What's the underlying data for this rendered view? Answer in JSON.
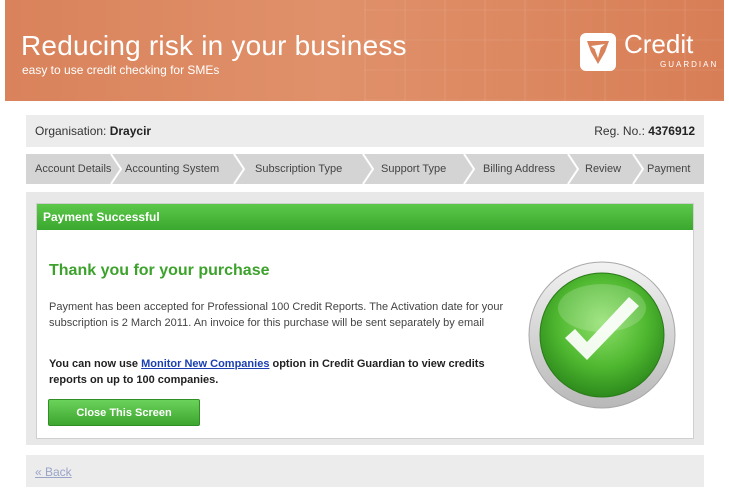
{
  "banner": {
    "title": "Reducing risk in your business",
    "subtitle": "easy to use credit checking for SMEs",
    "logo_name": "Credit",
    "logo_sub": "GUARDIAN"
  },
  "org": {
    "label": "Organisation:",
    "name": "Draycir",
    "reg_label": "Reg. No.:",
    "reg_no": "4376912"
  },
  "steps": [
    {
      "label": "Account Details"
    },
    {
      "label": "Accounting System"
    },
    {
      "label": "Subscription Type"
    },
    {
      "label": "Support Type"
    },
    {
      "label": "Billing Address"
    },
    {
      "label": "Review"
    },
    {
      "label": "Payment"
    }
  ],
  "panel": {
    "header": "Payment Successful",
    "heading": "Thank you for your purchase",
    "message": "Payment has been accepted for Professional 100 Credit Reports. The Activation date for your subscription is 2 March 2011. An invoice for this purchase will be sent separately by email",
    "note_prefix": "You can now use ",
    "note_link": "Monitor New Companies",
    "note_suffix": " option in Credit Guardian to view credits reports on up to 100 companies.",
    "close_button": "Close This Screen"
  },
  "back_link": "« Back",
  "colors": {
    "banner": "#d9825b",
    "success_green": "#3da22c",
    "link_blue": "#1a3fb0"
  },
  "icons": {
    "logo": "shield-arrow-icon",
    "status": "green-checkmark-icon"
  }
}
